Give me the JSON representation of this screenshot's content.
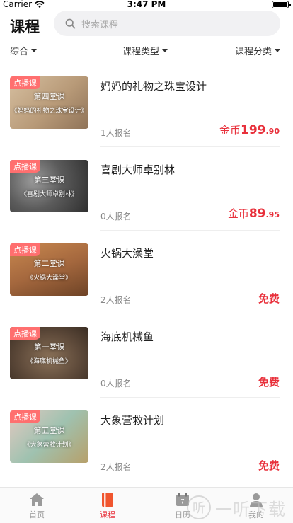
{
  "status_bar": {
    "carrier": "Carrier",
    "time": "3:47 PM"
  },
  "header": {
    "title": "课程",
    "search_placeholder": "搜索课程"
  },
  "filters": {
    "sort": "综合",
    "type": "课程类型",
    "category": "课程分类"
  },
  "courses": [
    {
      "badge": "点播课",
      "lesson": "第四堂课",
      "caption": "《妈妈的礼物之珠宝设计》",
      "name": "妈妈的礼物之珠宝设计",
      "enrolled": "1人报名",
      "price_prefix": "金币",
      "price_int": "199",
      "price_dec": ".90",
      "free_label": "",
      "thumb_color": "#b89a78"
    },
    {
      "badge": "点播课",
      "lesson": "第三堂课",
      "caption": "《喜剧大师卓别林》",
      "name": "喜剧大师卓别林",
      "enrolled": "0人报名",
      "price_prefix": "金币",
      "price_int": "89",
      "price_dec": ".95",
      "free_label": "",
      "thumb_color": "#5b5b5b"
    },
    {
      "badge": "点播课",
      "lesson": "第二堂课",
      "caption": "《火锅大澡堂》",
      "name": "火锅大澡堂",
      "enrolled": "2人报名",
      "price_prefix": "",
      "price_int": "",
      "price_dec": "",
      "free_label": "免费",
      "thumb_color": "#a5683e"
    },
    {
      "badge": "点播课",
      "lesson": "第一堂课",
      "caption": "《海底机械鱼》",
      "name": "海底机械鱼",
      "enrolled": "0人报名",
      "price_prefix": "",
      "price_int": "",
      "price_dec": "",
      "free_label": "免费",
      "thumb_color": "#5e4a3a"
    },
    {
      "badge": "点播课",
      "lesson": "第五堂课",
      "caption": "《大象营救计划》",
      "name": "大象营救计划",
      "enrolled": "2人报名",
      "price_prefix": "",
      "price_int": "",
      "price_dec": "",
      "free_label": "免费",
      "thumb_color": "#9fc2b0"
    }
  ],
  "tabbar": {
    "items": [
      {
        "label": "首页",
        "icon": "home-icon"
      },
      {
        "label": "课程",
        "icon": "course-icon",
        "active": true
      },
      {
        "label": "日历",
        "icon": "calendar-icon"
      },
      {
        "label": "我的",
        "icon": "profile-icon"
      }
    ]
  },
  "watermark": {
    "logo": "听",
    "text": "一听下载"
  },
  "colors": {
    "accent": "#e8303b",
    "badge": "#ff6f6f",
    "muted": "#888888",
    "search_bg": "#f1f1f3"
  }
}
